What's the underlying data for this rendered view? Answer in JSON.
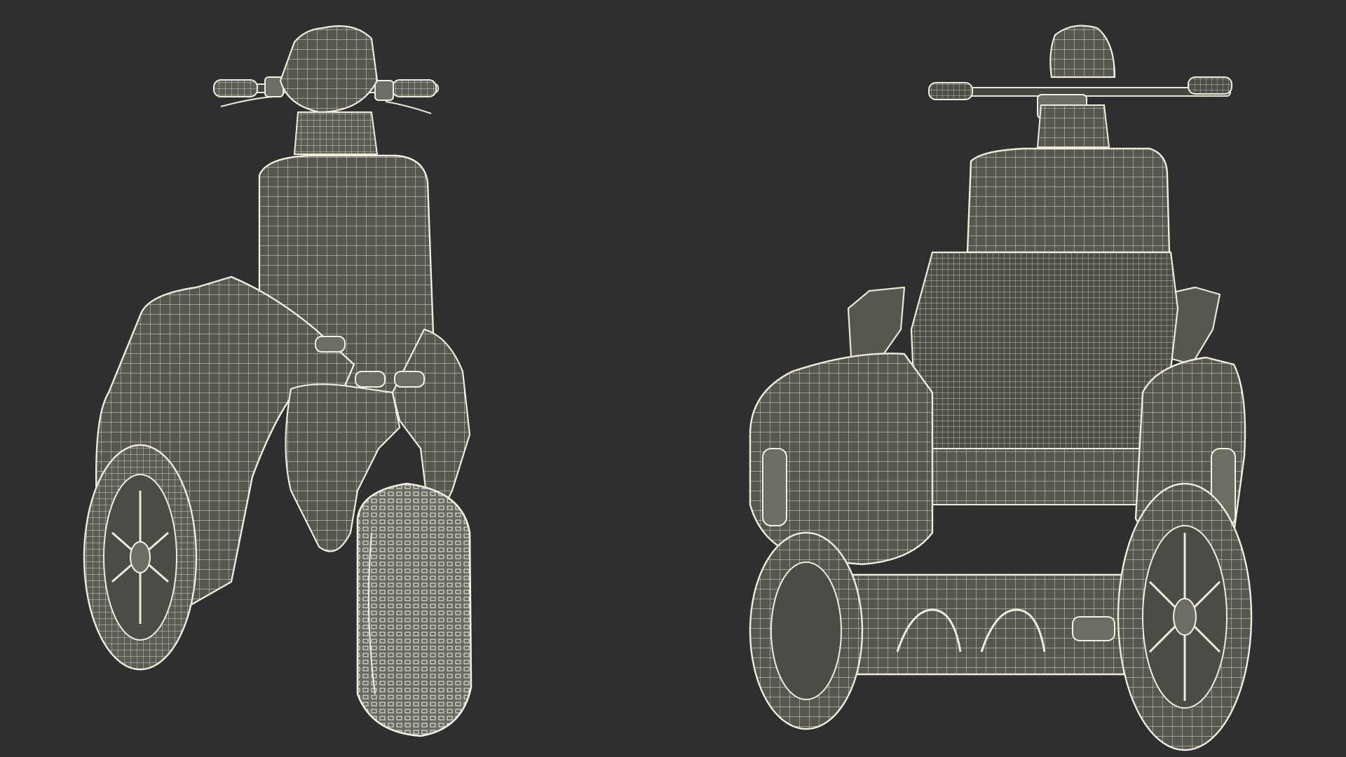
{
  "scene": {
    "background_color": "#2f2f2f",
    "mesh_color": "#e8e6d6",
    "surface_color": "#56574f",
    "views": [
      {
        "id": "front",
        "description_name": "wireframe-scooter-front-view"
      },
      {
        "id": "rear",
        "description_name": "wireframe-scooter-rear-view"
      }
    ]
  }
}
